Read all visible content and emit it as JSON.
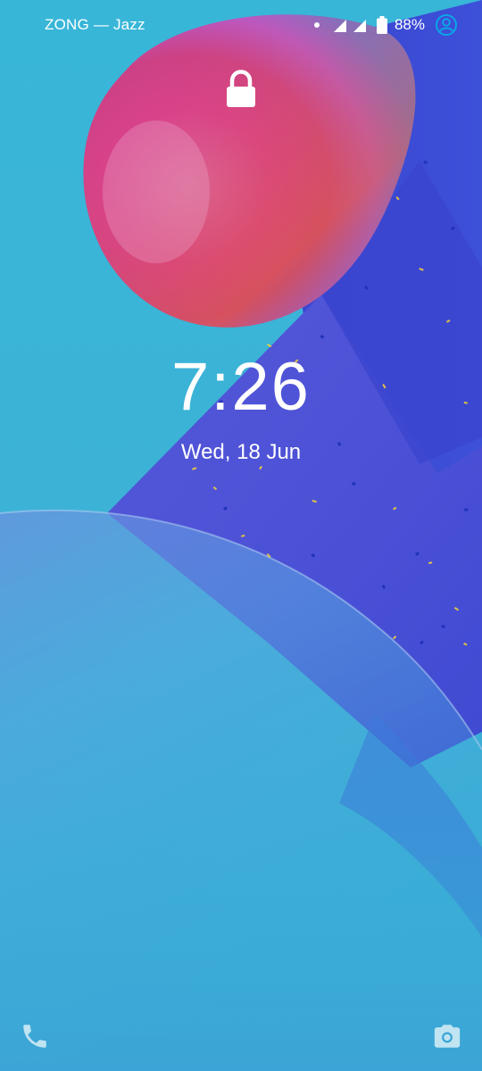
{
  "status_bar": {
    "carrier": "ZONG — Jazz",
    "battery_percent": "88%",
    "icons": [
      "notification-dot",
      "signal-icon",
      "signal-icon",
      "battery-icon",
      "account-icon"
    ]
  },
  "lock_screen": {
    "time": "7:26",
    "date": "Wed, 18 Jun"
  },
  "shortcuts": {
    "left": "phone-icon",
    "right": "camera-icon"
  },
  "colors": {
    "background": "#35b4d6",
    "foreground": "#ffffff"
  }
}
